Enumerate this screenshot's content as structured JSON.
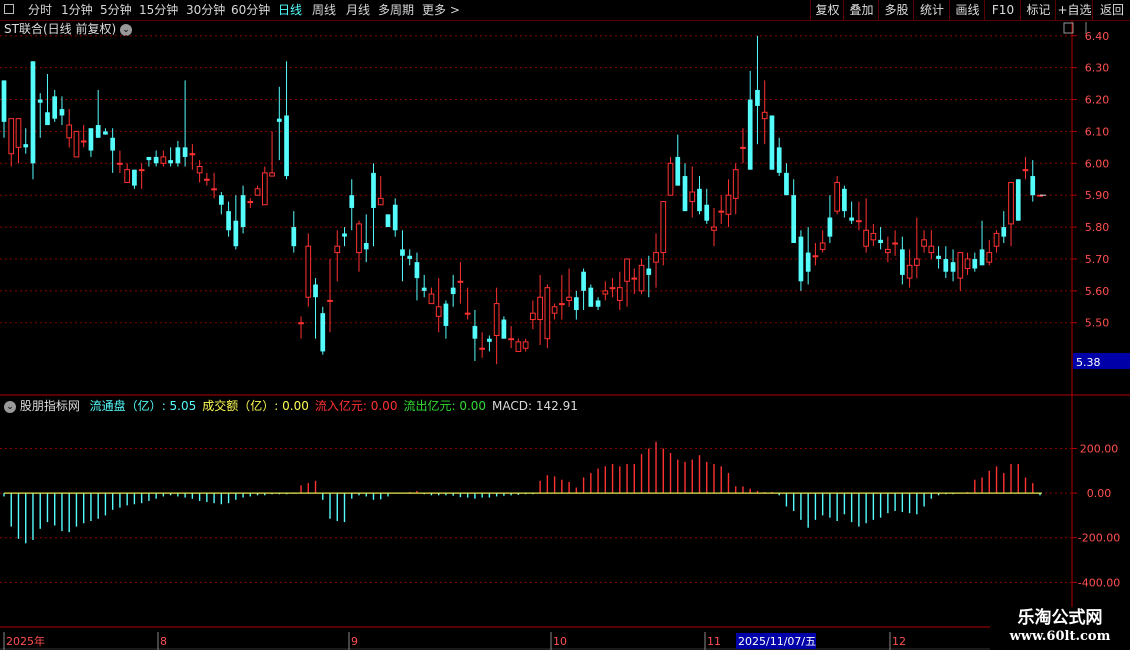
{
  "toolbar": {
    "left_items": [
      "分时",
      "1分钟",
      "5分钟",
      "15分钟",
      "30分钟",
      "60分钟",
      "日线",
      "周线",
      "月线",
      "多周期",
      "更多 >"
    ],
    "active_item": "日线",
    "right_items": [
      "复权",
      "叠加",
      "多股",
      "统计",
      "画线",
      "F10",
      "标记",
      "+自选",
      "返回"
    ]
  },
  "main_chart": {
    "title": "ST联合(日线 前复权)",
    "current_price_label": "5.38",
    "colors": {
      "up": "#ff3232",
      "down": "#54fcfc",
      "axis": "#b30000",
      "grid": "#8a0000",
      "tick": "#ff5050"
    }
  },
  "sub_chart": {
    "indicator_name": "股朋指标网",
    "items": [
      {
        "label": "流通盘（亿）",
        "value": ": 5.05",
        "color": "#54fcfc"
      },
      {
        "label": "成交额（亿）",
        "value": ": 0.00",
        "color": "#ffff54"
      },
      {
        "label": "流入亿元",
        "value": ": 0.00",
        "color": "#ff3232"
      },
      {
        "label": "流出亿元",
        "value": ": 0.00",
        "color": "#32dc32"
      },
      {
        "label": "MACD",
        "value": ": 142.91",
        "color": "#d8d8d8"
      }
    ]
  },
  "chart_data": [
    {
      "type": "candlestick",
      "yticks": [
        5.5,
        5.6,
        5.7,
        5.8,
        5.9,
        6.0,
        6.1,
        6.2,
        6.3,
        6.4
      ],
      "ylim": [
        5.38,
        6.44
      ],
      "ohlc": [
        [
          6.26,
          6.26,
          6.08,
          6.13
        ],
        [
          6.03,
          6.14,
          5.99,
          6.14
        ],
        [
          6.05,
          6.14,
          6.0,
          6.14
        ],
        [
          6.06,
          6.11,
          6.03,
          6.05
        ],
        [
          6.32,
          6.32,
          5.95,
          6.0
        ],
        [
          6.2,
          6.22,
          6.08,
          6.19
        ],
        [
          6.16,
          6.28,
          6.12,
          6.12
        ],
        [
          6.21,
          6.23,
          6.13,
          6.14
        ],
        [
          6.17,
          6.21,
          6.12,
          6.15
        ],
        [
          6.08,
          6.17,
          6.05,
          6.12
        ],
        [
          6.02,
          6.1,
          6.02,
          6.1
        ],
        [
          6.07,
          6.12,
          6.05,
          6.07
        ],
        [
          6.11,
          6.11,
          6.02,
          6.04
        ],
        [
          6.12,
          6.23,
          6.08,
          6.08
        ],
        [
          6.1,
          6.11,
          6.09,
          6.09
        ],
        [
          6.08,
          6.11,
          5.97,
          6.04
        ],
        [
          6.0,
          6.04,
          5.97,
          6.0
        ],
        [
          5.94,
          6.0,
          5.94,
          5.98
        ],
        [
          5.98,
          5.98,
          5.92,
          5.93
        ],
        [
          5.98,
          6.0,
          5.92,
          5.98
        ],
        [
          6.02,
          6.02,
          5.99,
          6.01
        ],
        [
          6.02,
          6.04,
          5.99,
          6.0
        ],
        [
          6.0,
          6.04,
          5.99,
          6.02
        ],
        [
          6.01,
          6.05,
          5.99,
          6.0
        ],
        [
          6.05,
          6.07,
          5.99,
          6.0
        ],
        [
          6.05,
          6.26,
          5.99,
          6.02
        ],
        [
          6.03,
          6.06,
          5.98,
          6.03
        ],
        [
          5.97,
          6.01,
          5.94,
          5.99
        ],
        [
          5.95,
          5.97,
          5.93,
          5.95
        ],
        [
          5.92,
          5.97,
          5.89,
          5.92
        ],
        [
          5.9,
          5.91,
          5.84,
          5.87
        ],
        [
          5.85,
          5.88,
          5.77,
          5.79
        ],
        [
          5.82,
          5.9,
          5.73,
          5.74
        ],
        [
          5.9,
          5.93,
          5.78,
          5.8
        ],
        [
          5.88,
          5.89,
          5.86,
          5.88
        ],
        [
          5.9,
          5.93,
          5.9,
          5.92
        ],
        [
          5.87,
          5.99,
          5.87,
          5.97
        ],
        [
          5.96,
          6.1,
          5.97,
          5.97
        ],
        [
          6.14,
          6.24,
          6.01,
          6.13
        ],
        [
          6.15,
          6.32,
          5.95,
          5.96
        ],
        [
          5.8,
          5.85,
          5.72,
          5.74
        ],
        [
          5.5,
          5.52,
          5.45,
          5.5
        ],
        [
          5.58,
          5.78,
          5.55,
          5.74
        ],
        [
          5.62,
          5.64,
          5.45,
          5.58
        ],
        [
          5.53,
          5.55,
          5.4,
          5.41
        ],
        [
          5.57,
          5.7,
          5.47,
          5.57
        ],
        [
          5.72,
          5.79,
          5.63,
          5.74
        ],
        [
          5.78,
          5.8,
          5.74,
          5.77
        ],
        [
          5.9,
          5.95,
          5.79,
          5.86
        ],
        [
          5.72,
          5.82,
          5.66,
          5.81
        ],
        [
          5.75,
          5.84,
          5.69,
          5.73
        ],
        [
          5.97,
          6.0,
          5.74,
          5.86
        ],
        [
          5.87,
          5.96,
          5.87,
          5.89
        ],
        [
          5.84,
          5.81,
          5.81,
          5.8
        ],
        [
          5.87,
          5.89,
          5.77,
          5.79
        ],
        [
          5.73,
          5.79,
          5.63,
          5.71
        ],
        [
          5.71,
          5.73,
          5.68,
          5.7
        ],
        [
          5.69,
          5.72,
          5.57,
          5.64
        ],
        [
          5.61,
          5.65,
          5.58,
          5.6
        ],
        [
          5.56,
          5.61,
          5.56,
          5.59
        ],
        [
          5.52,
          5.64,
          5.47,
          5.55
        ],
        [
          5.56,
          5.57,
          5.45,
          5.49
        ],
        [
          5.61,
          5.65,
          5.55,
          5.59
        ],
        [
          5.63,
          5.69,
          5.56,
          5.63
        ],
        [
          5.53,
          5.61,
          5.51,
          5.53
        ],
        [
          5.49,
          5.54,
          5.38,
          5.45
        ],
        [
          5.42,
          5.47,
          5.39,
          5.42
        ],
        [
          5.45,
          5.46,
          5.41,
          5.44
        ],
        [
          5.46,
          5.61,
          5.37,
          5.56
        ],
        [
          5.51,
          5.52,
          5.45,
          5.45
        ],
        [
          5.45,
          5.49,
          5.42,
          5.45
        ],
        [
          5.41,
          5.45,
          5.42,
          5.44
        ],
        [
          5.42,
          5.45,
          5.41,
          5.44
        ],
        [
          5.51,
          5.57,
          5.48,
          5.53
        ],
        [
          5.51,
          5.65,
          5.43,
          5.58
        ],
        [
          5.45,
          5.62,
          5.42,
          5.61
        ],
        [
          5.53,
          5.56,
          5.51,
          5.55
        ],
        [
          5.56,
          5.65,
          5.51,
          5.56
        ],
        [
          5.57,
          5.67,
          5.55,
          5.58
        ],
        [
          5.58,
          5.6,
          5.51,
          5.54
        ],
        [
          5.66,
          5.67,
          5.54,
          5.6
        ],
        [
          5.61,
          5.62,
          5.55,
          5.55
        ],
        [
          5.57,
          5.58,
          5.54,
          5.55
        ],
        [
          5.59,
          5.63,
          5.57,
          5.6
        ],
        [
          5.61,
          5.64,
          5.58,
          5.61
        ],
        [
          5.57,
          5.66,
          5.54,
          5.61
        ],
        [
          5.63,
          5.69,
          5.55,
          5.7
        ],
        [
          5.64,
          5.67,
          5.59,
          5.64
        ],
        [
          5.6,
          5.7,
          5.59,
          5.68
        ],
        [
          5.67,
          5.71,
          5.58,
          5.65
        ],
        [
          5.69,
          5.78,
          5.61,
          5.72
        ],
        [
          5.72,
          5.88,
          5.68,
          5.88
        ],
        [
          5.9,
          6.02,
          5.91,
          6.0
        ],
        [
          6.02,
          6.09,
          5.93,
          5.93
        ],
        [
          5.96,
          6.0,
          5.85,
          5.85
        ],
        [
          5.88,
          5.99,
          5.83,
          5.91
        ],
        [
          5.92,
          5.96,
          5.84,
          5.85
        ],
        [
          5.87,
          5.92,
          5.81,
          5.82
        ],
        [
          5.79,
          5.86,
          5.74,
          5.8
        ],
        [
          5.85,
          5.9,
          5.81,
          5.85
        ],
        [
          5.84,
          5.95,
          5.8,
          5.9
        ],
        [
          5.89,
          6.0,
          5.84,
          5.98
        ],
        [
          6.05,
          6.11,
          6.0,
          6.05
        ],
        [
          6.2,
          6.29,
          5.98,
          5.98
        ],
        [
          6.23,
          6.4,
          6.06,
          6.18
        ],
        [
          6.14,
          6.26,
          6.06,
          6.16
        ],
        [
          6.15,
          6.15,
          5.98,
          5.98
        ],
        [
          6.05,
          6.08,
          5.96,
          5.97
        ],
        [
          5.97,
          6.0,
          5.9,
          5.9
        ],
        [
          5.9,
          5.95,
          5.75,
          5.75
        ],
        [
          5.77,
          5.79,
          5.6,
          5.63
        ],
        [
          5.72,
          5.8,
          5.62,
          5.66
        ],
        [
          5.71,
          5.75,
          5.68,
          5.71
        ],
        [
          5.73,
          5.79,
          5.72,
          5.75
        ],
        [
          5.83,
          5.9,
          5.75,
          5.77
        ],
        [
          5.85,
          5.96,
          5.84,
          5.94
        ],
        [
          5.92,
          5.93,
          5.83,
          5.85
        ],
        [
          5.83,
          5.88,
          5.81,
          5.82
        ],
        [
          5.82,
          5.88,
          5.79,
          5.82
        ],
        [
          5.74,
          5.89,
          5.72,
          5.79
        ],
        [
          5.76,
          5.81,
          5.74,
          5.78
        ],
        [
          5.76,
          5.8,
          5.73,
          5.75
        ],
        [
          5.72,
          5.77,
          5.69,
          5.73
        ],
        [
          5.75,
          5.79,
          5.71,
          5.75
        ],
        [
          5.73,
          5.77,
          5.62,
          5.65
        ],
        [
          5.64,
          5.73,
          5.61,
          5.68
        ],
        [
          5.68,
          5.83,
          5.64,
          5.7
        ],
        [
          5.74,
          5.79,
          5.72,
          5.76
        ],
        [
          5.72,
          5.79,
          5.7,
          5.74
        ],
        [
          5.71,
          5.74,
          5.67,
          5.7
        ],
        [
          5.7,
          5.74,
          5.64,
          5.66
        ],
        [
          5.69,
          5.73,
          5.63,
          5.66
        ],
        [
          5.64,
          5.72,
          5.6,
          5.72
        ],
        [
          5.67,
          5.72,
          5.65,
          5.7
        ],
        [
          5.7,
          5.72,
          5.66,
          5.67
        ],
        [
          5.73,
          5.82,
          5.69,
          5.68
        ],
        [
          5.69,
          5.76,
          5.68,
          5.72
        ],
        [
          5.74,
          5.79,
          5.72,
          5.78
        ],
        [
          5.8,
          5.85,
          5.75,
          5.77
        ],
        [
          5.81,
          5.94,
          5.74,
          5.94
        ],
        [
          5.95,
          5.95,
          5.82,
          5.82
        ],
        [
          5.98,
          6.02,
          5.95,
          5.98
        ],
        [
          5.96,
          6.01,
          5.88,
          5.9
        ],
        [
          5.9,
          5.9,
          5.9,
          5.9
        ]
      ]
    },
    {
      "type": "bar",
      "series": [
        {
          "name": "MACD",
          "values": [
            -15,
            -150,
            -205,
            -225,
            -210,
            -160,
            -130,
            -145,
            -170,
            -175,
            -150,
            -135,
            -125,
            -115,
            -100,
            -75,
            -65,
            -55,
            -50,
            -45,
            -35,
            -25,
            -15,
            -10,
            -15,
            -20,
            -25,
            -35,
            -40,
            -45,
            -50,
            -45,
            -30,
            -20,
            -15,
            -10,
            -10,
            -5,
            -5,
            -5,
            -3,
            35,
            45,
            55,
            -30,
            -115,
            -125,
            -130,
            -25,
            -10,
            -15,
            -30,
            -28,
            -15,
            -2,
            -2,
            5,
            10,
            -5,
            -10,
            -10,
            -10,
            -12,
            -18,
            -20,
            -25,
            -20,
            -20,
            -15,
            -12,
            -10,
            -8,
            -5,
            -5,
            55,
            80,
            75,
            60,
            50,
            25,
            70,
            90,
            110,
            120,
            130,
            120,
            130,
            130,
            175,
            200,
            230,
            200,
            180,
            150,
            140,
            150,
            170,
            140,
            130,
            120,
            90,
            30,
            30,
            20,
            10,
            5,
            5,
            -10,
            -60,
            -80,
            -120,
            -155,
            -120,
            -100,
            -110,
            -125,
            -95,
            -130,
            -150,
            -135,
            -120,
            -110,
            -90,
            -80,
            -85,
            -90,
            -95,
            -60,
            -25,
            -10,
            -5,
            -5,
            0,
            5,
            60,
            70,
            100,
            120,
            90,
            130,
            130,
            70,
            45,
            -10
          ]
        }
      ],
      "yticks": [
        200.0,
        0.0,
        -200.0,
        -400.0
      ],
      "ylim": [
        -600,
        350
      ]
    }
  ],
  "date_labels": [
    "2025年",
    "8",
    "9",
    "10",
    "11",
    "12"
  ],
  "selected_date": "2025/11/07/五",
  "watermark": {
    "title": "乐淘公式网",
    "url": "www.60lt.com"
  }
}
